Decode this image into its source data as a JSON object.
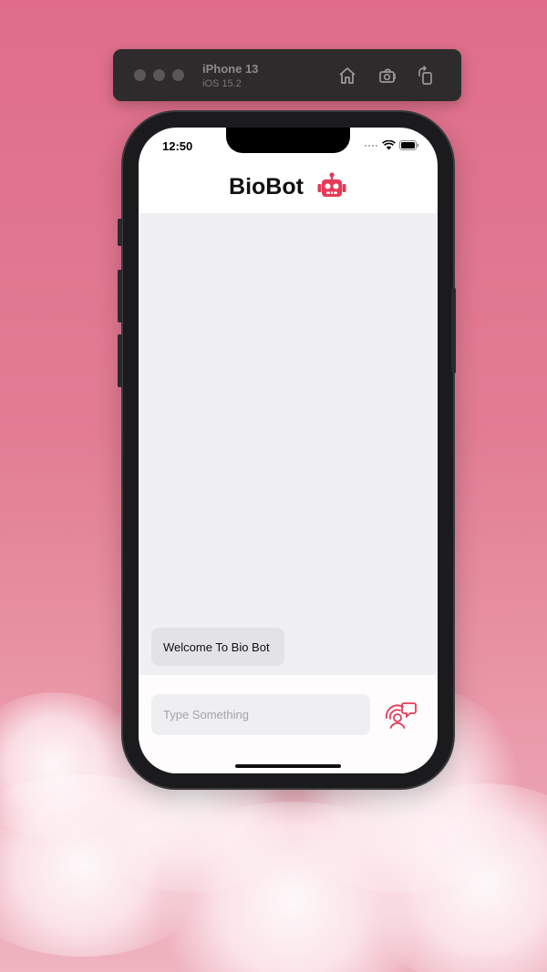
{
  "simulator": {
    "device_name": "iPhone 13",
    "os_version": "iOS 15.2",
    "icons": [
      "home-icon",
      "screenshot-icon",
      "rotate-icon"
    ]
  },
  "status_bar": {
    "time": "12:50",
    "icons": [
      "signal-icon",
      "wifi-icon",
      "battery-icon"
    ]
  },
  "app": {
    "title": "BioBot",
    "logo_icon": "robot-icon",
    "accent_color": "#e63a57"
  },
  "chat": {
    "messages": [
      {
        "text": "Welcome To Bio Bot",
        "sender": "bot"
      }
    ]
  },
  "composer": {
    "placeholder": "Type Something",
    "value": "",
    "send_icon": "voice-chat-icon"
  }
}
